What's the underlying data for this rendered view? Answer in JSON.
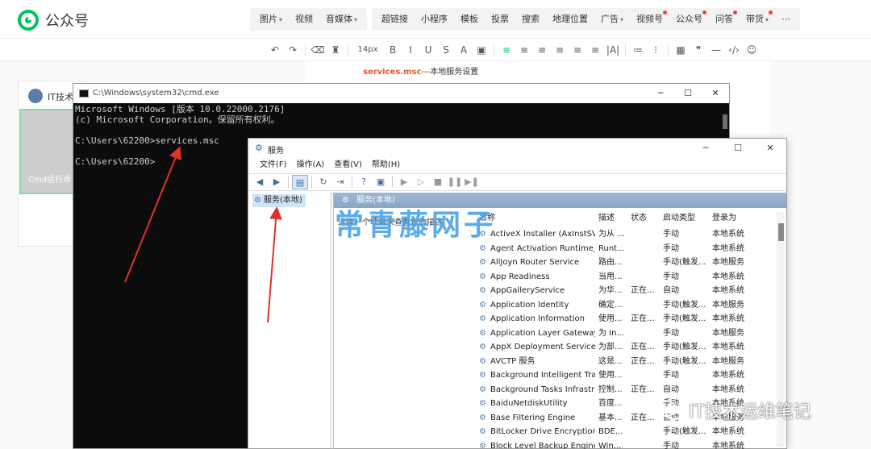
{
  "app": {
    "name": "公众号",
    "logo_icon": "wechat-mp-logo-icon"
  },
  "menu": {
    "group1": [
      {
        "label": "图片",
        "caret": "▾"
      },
      {
        "label": "视频"
      },
      {
        "label": "音媒体",
        "caret": "▾"
      }
    ],
    "group2": [
      {
        "label": "超链接"
      },
      {
        "label": "小程序"
      },
      {
        "label": "模板"
      },
      {
        "label": "投票"
      },
      {
        "label": "搜索"
      },
      {
        "label": "地理位置"
      },
      {
        "label": "广告",
        "caret": "▾"
      },
      {
        "label": "视频号",
        "dot": true
      },
      {
        "label": "公众号",
        "dot": true
      },
      {
        "label": "问答",
        "dot": true
      },
      {
        "label": "带货",
        "caret": "▾",
        "dot": true
      },
      {
        "label": "⋯"
      }
    ]
  },
  "toolbar": {
    "font_size": "14px",
    "items": [
      "↶",
      "↷",
      "⌫",
      "♜",
      "14px",
      "B",
      "I",
      "U",
      "S",
      "A",
      "▣",
      "≡",
      "≡",
      "≡",
      "≡",
      "≡",
      "≡",
      "|A|",
      "≔",
      "⁝",
      "▦",
      "❞",
      "—",
      "‹/›",
      "☺"
    ]
  },
  "editor": {
    "services_cmd": "services.msc",
    "services_desc": "---本地服务设置"
  },
  "left_card": {
    "title": "IT技术",
    "caption": "Cmd运行命"
  },
  "cmd": {
    "title": "C:\\Windows\\system32\\cmd.exe",
    "lines": [
      "Microsoft Windows [版本 10.0.22000.2176]",
      "(c) Microsoft Corporation。保留所有权利。",
      "",
      "C:\\Users\\62200>services.msc",
      "",
      "C:\\Users\\62200>"
    ]
  },
  "services": {
    "title": "服务",
    "menus": [
      "文件(F)",
      "操作(A)",
      "查看(V)",
      "帮助(H)"
    ],
    "tree_item": "服务(本地)",
    "pane_header": "服务(本地)",
    "pane_left_text": "选择一个项目来查看它的描述。",
    "columns": {
      "name": "名称",
      "desc": "描述",
      "status": "状态",
      "startup": "启动类型",
      "login": "登录为"
    },
    "rows": [
      {
        "name": "ActiveX Installer (AxInstSV)",
        "desc": "为从 ...",
        "status": "",
        "startup": "手动",
        "login": "本地系统"
      },
      {
        "name": "Agent Activation Runtime_...",
        "desc": "Runt...",
        "status": "",
        "startup": "手动",
        "login": "本地系统"
      },
      {
        "name": "AllJoyn Router Service",
        "desc": "路由...",
        "status": "",
        "startup": "手动(触发...",
        "login": "本地服务"
      },
      {
        "name": "App Readiness",
        "desc": "当用...",
        "status": "",
        "startup": "手动",
        "login": "本地系统"
      },
      {
        "name": "AppGalleryService",
        "desc": "为华...",
        "status": "正在...",
        "startup": "自动",
        "login": "本地系统"
      },
      {
        "name": "Application Identity",
        "desc": "确定...",
        "status": "",
        "startup": "手动(触发...",
        "login": "本地服务"
      },
      {
        "name": "Application Information",
        "desc": "使用...",
        "status": "正在...",
        "startup": "手动(触发...",
        "login": "本地系统"
      },
      {
        "name": "Application Layer Gateway ...",
        "desc": "为 In...",
        "status": "",
        "startup": "手动",
        "login": "本地服务"
      },
      {
        "name": "AppX Deployment Service ...",
        "desc": "为部...",
        "status": "正在...",
        "startup": "手动(触发...",
        "login": "本地系统"
      },
      {
        "name": "AVCTP 服务",
        "desc": "这是...",
        "status": "正在...",
        "startup": "手动(触发...",
        "login": "本地服务"
      },
      {
        "name": "Background Intelligent Tra...",
        "desc": "使用...",
        "status": "",
        "startup": "手动",
        "login": "本地系统"
      },
      {
        "name": "Background Tasks Infrastru...",
        "desc": "控制...",
        "status": "正在...",
        "startup": "自动",
        "login": "本地系统"
      },
      {
        "name": "BaiduNetdiskUtility",
        "desc": "百度...",
        "status": "",
        "startup": "手动",
        "login": "本地系统"
      },
      {
        "name": "Base Filtering Engine",
        "desc": "基本...",
        "status": "正在...",
        "startup": "自动",
        "login": "本地服务"
      },
      {
        "name": "BitLocker Drive Encryption ...",
        "desc": "BDE...",
        "status": "",
        "startup": "手动(触发...",
        "login": "本地系统"
      },
      {
        "name": "Block Level Backup Engine ...",
        "desc": "Win...",
        "status": "",
        "startup": "手动",
        "login": "本地系统"
      }
    ]
  },
  "watermark": {
    "center": "常青藤网子",
    "brand": "IT技术运维笔记"
  },
  "colors": {
    "accent": "#07c160",
    "arrow": "#e0322a",
    "watermark": "#4aa3ea",
    "highlight": "#e8582c"
  }
}
